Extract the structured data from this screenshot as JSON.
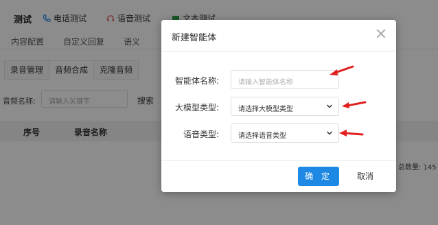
{
  "app": {
    "title": "测试",
    "top_tabs": [
      {
        "label": "电话测试",
        "icon": "phone-icon"
      },
      {
        "label": "语音测试",
        "icon": "headset-icon"
      },
      {
        "label": "文本测试",
        "icon": "chat-icon"
      }
    ],
    "subnav": [
      "内容配置",
      "自定义回复",
      "语义"
    ],
    "tabs": [
      "录音管理",
      "音频合成",
      "克隆音频"
    ],
    "search_label": "音频名称:",
    "search_placeholder": "请输入关键字",
    "search_button": "搜索",
    "table_headers": [
      "序号",
      "录音名称"
    ],
    "total": "总数量: 145"
  },
  "dialog": {
    "title": "新建智能体",
    "fields": [
      {
        "label": "智能体名称:",
        "placeholder": "请输入智能体名称",
        "type": "input"
      },
      {
        "label": "大模型类型:",
        "value": "请选择大模型类型",
        "type": "select"
      },
      {
        "label": "语音类型:",
        "value": "请选择语音类型",
        "type": "select"
      }
    ],
    "ok_label": "确 定",
    "cancel_label": "取消"
  },
  "colors": {
    "primary": "#1e88e5",
    "annotation_arrow": "#e02020",
    "phone_icon": "#1e88e5",
    "headset_icon": "#e05050",
    "chat_icon": "#2e9e4a"
  }
}
